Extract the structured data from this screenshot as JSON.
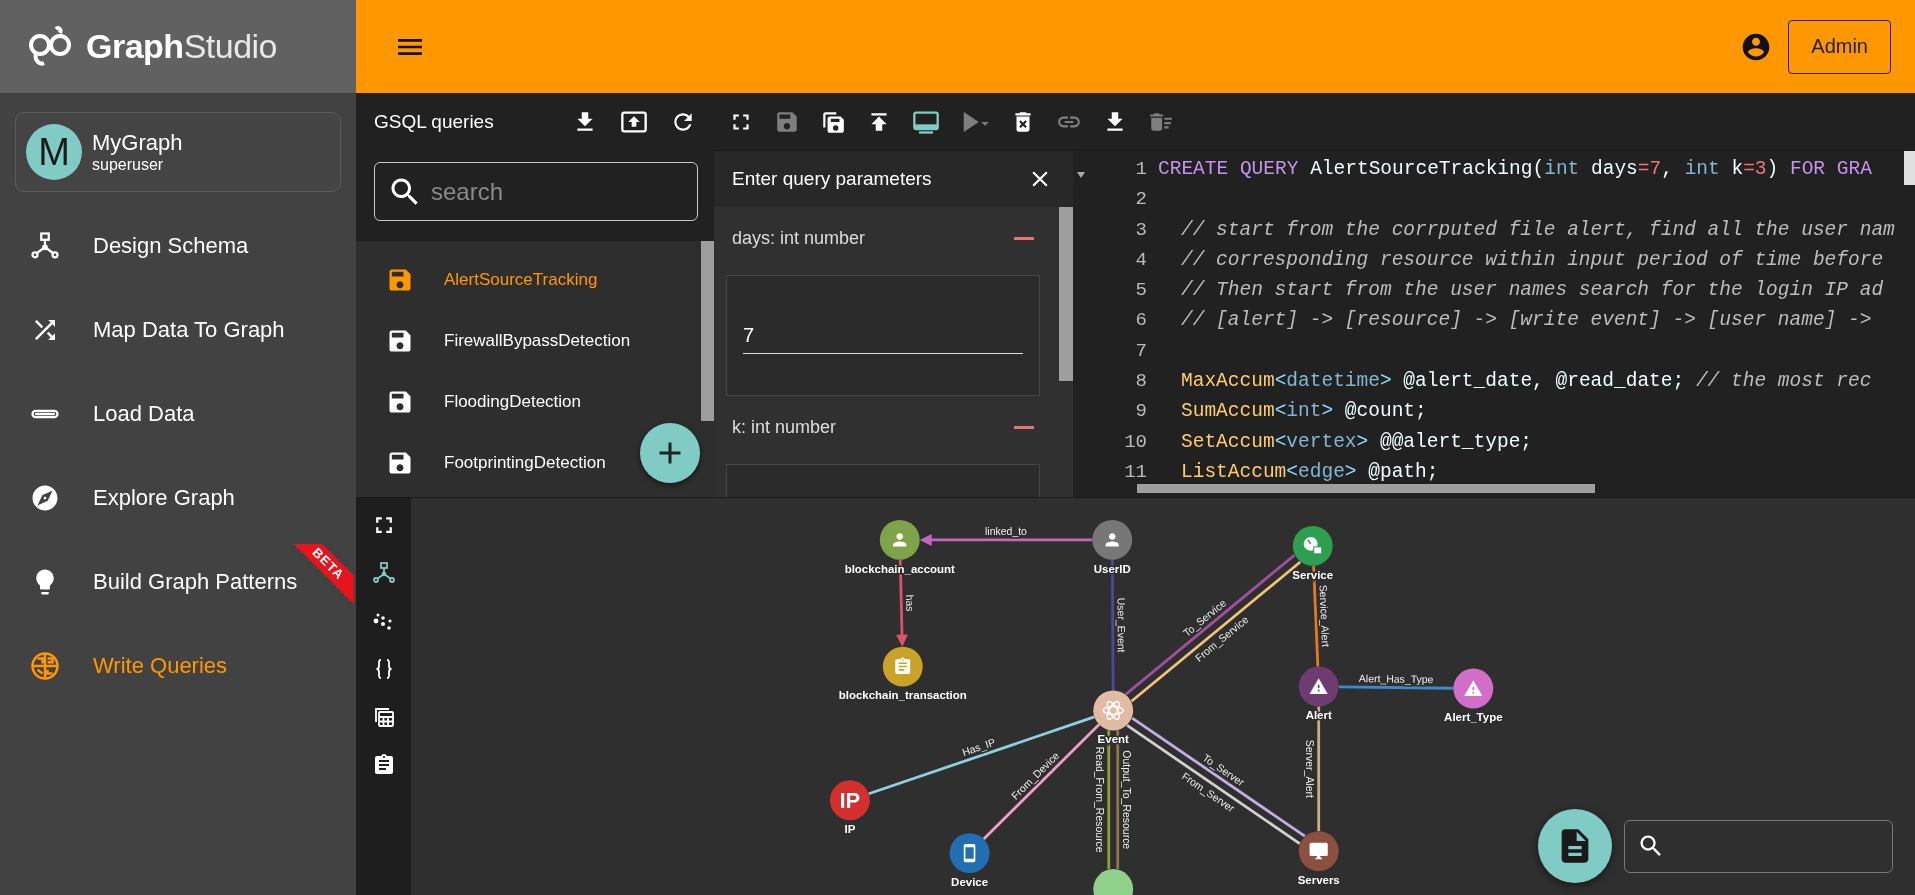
{
  "logo": {
    "text": "**Graph**Studio"
  },
  "topbar": {
    "user_button": "Admin"
  },
  "graph_card": {
    "avatar": "M",
    "name": "MyGraph",
    "role": "superuser"
  },
  "nav": [
    {
      "label": "Design Schema",
      "selected": false
    },
    {
      "label": "Map Data To Graph",
      "selected": false
    },
    {
      "label": "Load Data",
      "selected": false
    },
    {
      "label": "Explore Graph",
      "selected": false
    },
    {
      "label": "Build Graph Patterns",
      "selected": false,
      "badge": "BETA"
    },
    {
      "label": "Write Queries",
      "selected": true
    }
  ],
  "queries": {
    "title": "GSQL queries",
    "search": {
      "placeholder": "search"
    },
    "items": [
      {
        "name": "AlertSourceTracking",
        "selected": true
      },
      {
        "name": "FirewallBypassDetection",
        "selected": false
      },
      {
        "name": "FloodingDetection",
        "selected": false
      },
      {
        "name": "FootprintingDetection",
        "selected": false
      }
    ]
  },
  "editor_toolbar": [
    {
      "kind": "fullscreen",
      "disabled": false,
      "on": false
    },
    {
      "kind": "save",
      "disabled": true,
      "on": false
    },
    {
      "kind": "save-all",
      "disabled": false,
      "on": false
    },
    {
      "kind": "publish",
      "disabled": false,
      "on": false
    },
    {
      "kind": "console",
      "disabled": false,
      "on": true
    },
    {
      "kind": "run",
      "disabled": true,
      "on": false
    },
    {
      "kind": "delete",
      "disabled": false,
      "on": false
    },
    {
      "kind": "link",
      "disabled": true,
      "on": false
    },
    {
      "kind": "download",
      "disabled": false,
      "on": false
    },
    {
      "kind": "clear",
      "disabled": true,
      "on": false
    }
  ],
  "params": {
    "title": "Enter query parameters",
    "fields": [
      {
        "label": "days: int number",
        "value": "7"
      },
      {
        "label": "k: int number"
      }
    ]
  },
  "code": {
    "lines": [
      {
        "number": "1",
        "indented": false,
        "tokens": [
          {
            "text": "CREATE QUERY",
            "kind": "keyword"
          },
          {
            "text": " AlertSourceTracking(",
            "kind": "plain"
          },
          {
            "text": "int",
            "kind": "type"
          },
          {
            "text": " days",
            "kind": "plain"
          },
          {
            "text": "=7",
            "kind": "number"
          },
          {
            "text": ", ",
            "kind": "plain"
          },
          {
            "text": "int",
            "kind": "type"
          },
          {
            "text": " k",
            "kind": "plain"
          },
          {
            "text": "=3",
            "kind": "number"
          },
          {
            "text": ") ",
            "kind": "plain"
          },
          {
            "text": "FOR GRA",
            "kind": "keyword"
          }
        ]
      },
      {
        "number": "2"
      },
      {
        "number": "3",
        "indented": true,
        "tokens": [
          {
            "text": "// start from the corrputed file alert, find all the user nam",
            "kind": "comment"
          }
        ]
      },
      {
        "number": "4",
        "indented": true,
        "tokens": [
          {
            "text": "// corresponding resource within input period of time before",
            "kind": "comment"
          }
        ]
      },
      {
        "number": "5",
        "indented": true,
        "tokens": [
          {
            "text": "// Then start from the user names search for the login IP ad",
            "kind": "comment"
          }
        ]
      },
      {
        "number": "6",
        "indented": true,
        "tokens": [
          {
            "text": "// [alert] -> [resource] -> [write event] -> [user name] ->",
            "kind": "comment"
          }
        ]
      },
      {
        "number": "7"
      },
      {
        "number": "8",
        "indented": true,
        "tokens": [
          {
            "text": "MaxAccum",
            "kind": "accum"
          },
          {
            "text": "<",
            "kind": "bracket"
          },
          {
            "text": "datetime",
            "kind": "type"
          },
          {
            "text": ">",
            "kind": "bracket"
          },
          {
            "text": " @alert_date, @read_date;",
            "kind": "plain"
          },
          {
            "text": " // the most rec",
            "kind": "comment"
          }
        ]
      },
      {
        "number": "9",
        "indented": true,
        "tokens": [
          {
            "text": "SumAccum",
            "kind": "accum"
          },
          {
            "text": "<",
            "kind": "bracket"
          },
          {
            "text": "int",
            "kind": "type"
          },
          {
            "text": ">",
            "kind": "bracket"
          },
          {
            "text": " @count;",
            "kind": "plain"
          }
        ]
      },
      {
        "number": "10",
        "indented": true,
        "tokens": [
          {
            "text": "SetAccum",
            "kind": "accum"
          },
          {
            "text": "<",
            "kind": "bracket"
          },
          {
            "text": "vertex",
            "kind": "type"
          },
          {
            "text": ">",
            "kind": "bracket"
          },
          {
            "text": " @@alert_type;",
            "kind": "plain"
          }
        ]
      },
      {
        "number": "11",
        "indented": true,
        "tokens": [
          {
            "text": "ListAccum",
            "kind": "accum"
          },
          {
            "text": "<",
            "kind": "bracket"
          },
          {
            "text": "edge",
            "kind": "type"
          },
          {
            "text": ">",
            "kind": "bracket"
          },
          {
            "text": " @path;",
            "kind": "plain"
          }
        ]
      }
    ]
  },
  "graph_tools": [
    {
      "kind": "fit",
      "selected": false
    },
    {
      "kind": "schema",
      "selected": true
    },
    {
      "kind": "scatter",
      "selected": false
    },
    {
      "kind": "code",
      "selected": false
    },
    {
      "kind": "table",
      "selected": false
    },
    {
      "kind": "clipboard",
      "selected": false
    }
  ],
  "graph": {
    "nodes": [
      {
        "label": "blockchain_account",
        "color": "#7fa34a"
      },
      {
        "label": "UserID",
        "color": "#777777"
      },
      {
        "label": "Service",
        "color": "#2e9e4f"
      },
      {
        "label": "blockchain_transaction",
        "color": "#c9a227"
      },
      {
        "label": "Event",
        "color": "#e2bba5"
      },
      {
        "label": "Alert",
        "color": "#6e3c70"
      },
      {
        "label": "Alert_Type",
        "color": "#d06ec8"
      },
      {
        "label": "IP",
        "color": "#d32f2f",
        "icon_text": "IP"
      },
      {
        "label": "Device",
        "color": "#1f6fb2"
      },
      {
        "label": "Servers",
        "color": "#8d5040"
      },
      {
        "color": "#8fd18a"
      }
    ],
    "edges": [
      {
        "label": "linked_to",
        "color": "#c465c4",
        "directed": true
      },
      {
        "label": "has",
        "color": "#d9536a",
        "directed": true
      },
      {
        "label": "User_Event",
        "color": "#4a4a9a",
        "directed": false
      },
      {
        "label": "From_Service",
        "color": "#f5c17a",
        "directed": false
      },
      {
        "label": "To_Service",
        "color": "#a050a0",
        "directed": false
      },
      {
        "label": "Service_Alert",
        "color": "#e07b20",
        "directed": false
      },
      {
        "label": "Alert_Has_Type",
        "color": "#3a8ad0",
        "directed": false
      },
      {
        "label": "Server_Alert",
        "color": "#c8b080",
        "directed": false
      },
      {
        "label": "To_Server",
        "color": "#c0b0e0",
        "directed": false
      },
      {
        "label": "From_Server",
        "color": "#d0d0d0",
        "directed": false
      },
      {
        "label": "Has_IP",
        "color": "#8fd0e0",
        "directed": false
      },
      {
        "label": "From_Device",
        "color": "#f0a0c0",
        "directed": false
      },
      {
        "label": "Output_To_Resource",
        "color": "#8a7a40",
        "directed": false
      },
      {
        "label": "Read_From_Resource",
        "color": "#90a040",
        "directed": false
      }
    ]
  }
}
